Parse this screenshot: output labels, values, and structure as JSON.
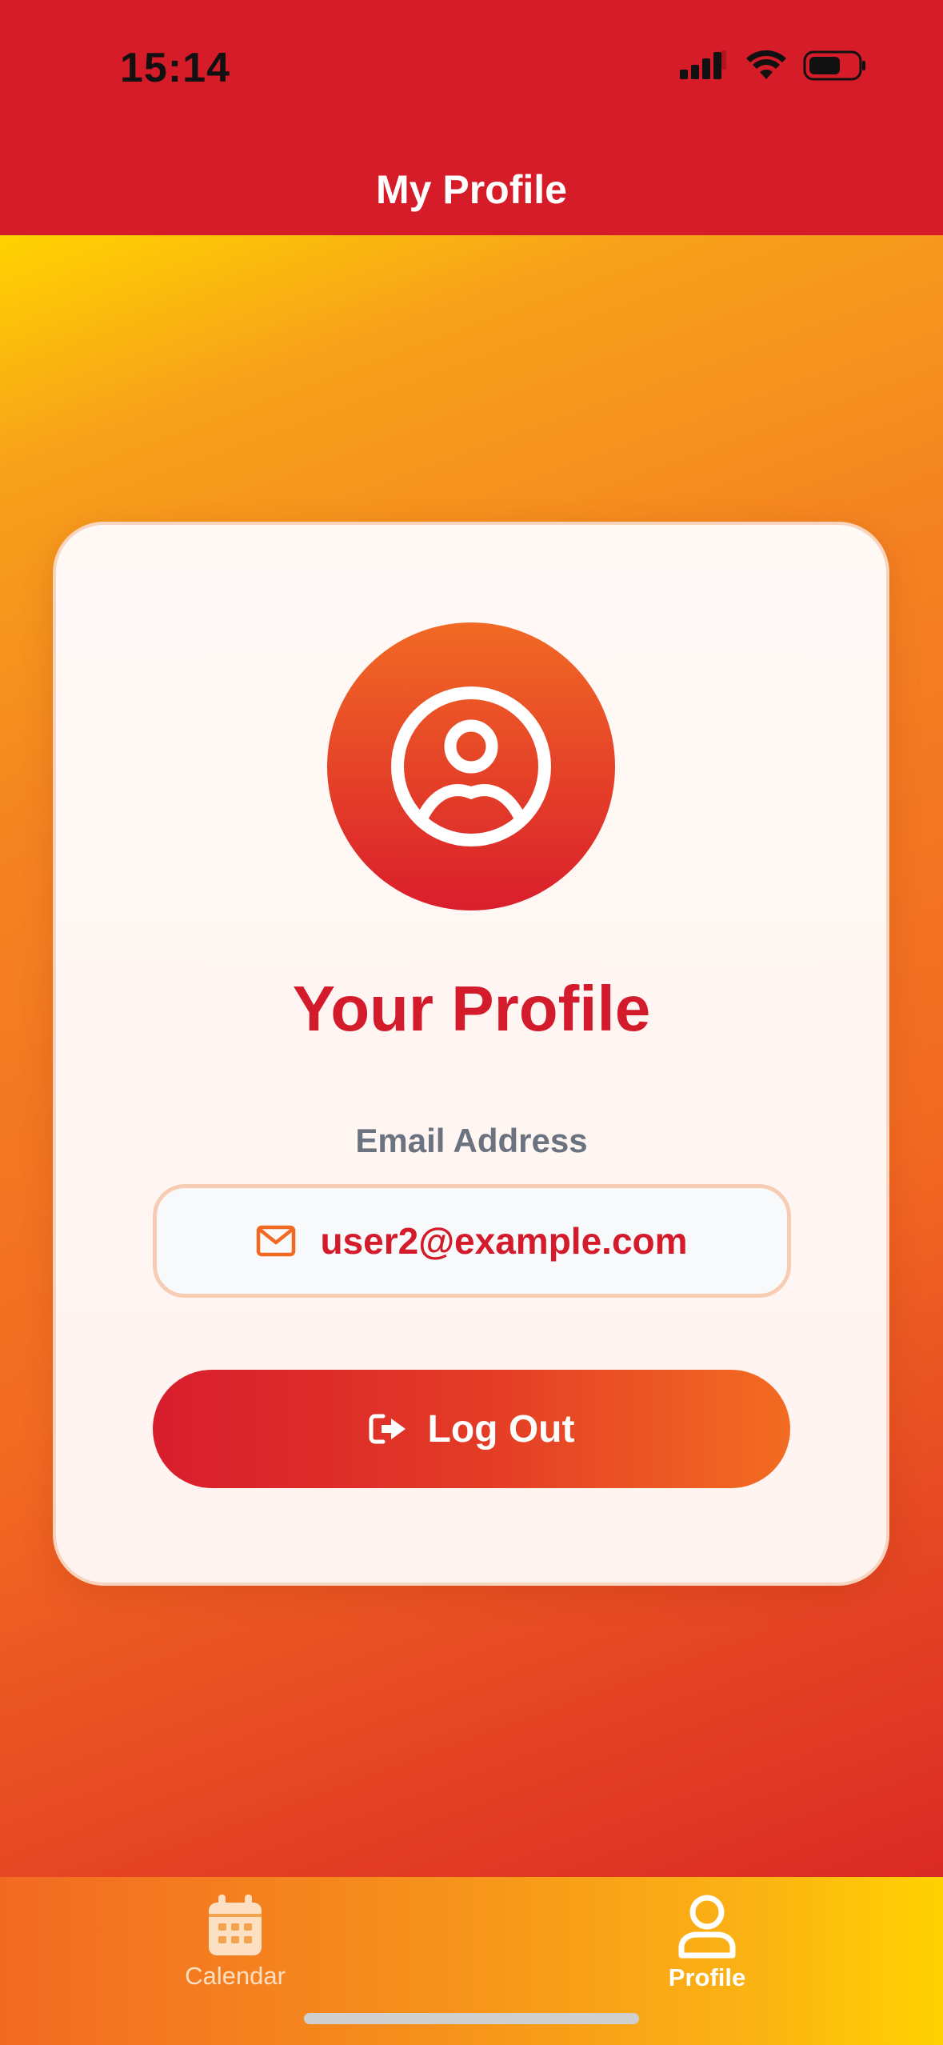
{
  "status_bar": {
    "time": "15:14"
  },
  "header": {
    "title": "My Profile"
  },
  "profile_card": {
    "heading": "Your Profile",
    "email_label": "Email Address",
    "email_value": "user2@example.com",
    "logout_label": "Log Out"
  },
  "tab_bar": {
    "tabs": [
      {
        "label": "Calendar",
        "icon": "calendar-icon",
        "active": false
      },
      {
        "label": "Profile",
        "icon": "person-icon",
        "active": true
      }
    ]
  },
  "colors": {
    "header": "#d61b29",
    "accent_red": "#d41b2b",
    "accent_orange": "#f36c22",
    "gradient_yellow": "#ffd300"
  }
}
